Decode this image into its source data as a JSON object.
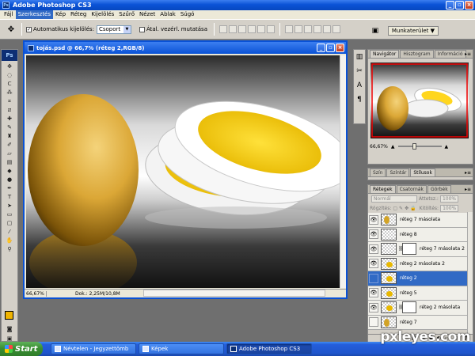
{
  "app": {
    "title": "Adobe Photoshop CS3"
  },
  "menu": [
    "Fájl",
    "Szerkesztés",
    "Kép",
    "Réteg",
    "Kijelölés",
    "Szűrő",
    "Nézet",
    "Ablak",
    "Súgó"
  ],
  "options": {
    "auto_select_label": "Automatikus kijelölés:",
    "auto_select_value": "Csoport",
    "transform_label": "Átal. vezérl. mutatása",
    "workspace_label": "Munkaterület"
  },
  "document": {
    "title": "tojás.psd @ 66,7% (réteg 2,RGB/8)",
    "zoom": "66,67%",
    "doc_size": "Dok.: 2,25M/10,8M"
  },
  "navigator": {
    "tabs": [
      "Navigátor",
      "Hisztogram",
      "Információ"
    ],
    "zoom": "66,67%"
  },
  "color_panel": {
    "tabs": [
      "Szín",
      "Színtár",
      "Stílusok"
    ]
  },
  "layers": {
    "tabs": [
      "Rétegek",
      "Csatornák",
      "Görbék"
    ],
    "blend_mode": "Normál",
    "opacity_label": "Áttetsz.:",
    "opacity_value": "100%",
    "lock_label": "Rögzítés:",
    "fill_label": "Kitöltés:",
    "fill_value": "100%",
    "items": [
      {
        "name": "réteg 7 másolata",
        "visible": true,
        "thumb": "egg",
        "mask": false,
        "selected": false
      },
      {
        "name": "réteg 8",
        "visible": true,
        "thumb": "empty",
        "mask": false,
        "selected": false
      },
      {
        "name": "réteg 7 másolata 2",
        "visible": true,
        "thumb": "empty",
        "mask": true,
        "selected": false
      },
      {
        "name": "réteg 2 másolata 2",
        "visible": true,
        "thumb": "blob",
        "mask": false,
        "selected": false
      },
      {
        "name": "réteg 2",
        "visible": false,
        "thumb": "blob",
        "mask": false,
        "selected": true
      },
      {
        "name": "réteg 5",
        "visible": true,
        "thumb": "blob",
        "mask": false,
        "selected": false
      },
      {
        "name": "réteg 2 másolata",
        "visible": true,
        "thumb": "blob",
        "mask": true,
        "selected": false
      },
      {
        "name": "réteg 7",
        "visible": false,
        "thumb": "egg",
        "mask": false,
        "selected": false
      }
    ]
  },
  "taskbar": {
    "start": "Start",
    "tasks": [
      "Névtelen - Jegyzettömb",
      "Képek",
      "Adobe Photoshop CS3"
    ]
  },
  "watermark": "pxleyes.com",
  "colors": {
    "egg": "#d9a531",
    "yolk": "#f2c600",
    "xp_blue": "#0a52d6"
  }
}
